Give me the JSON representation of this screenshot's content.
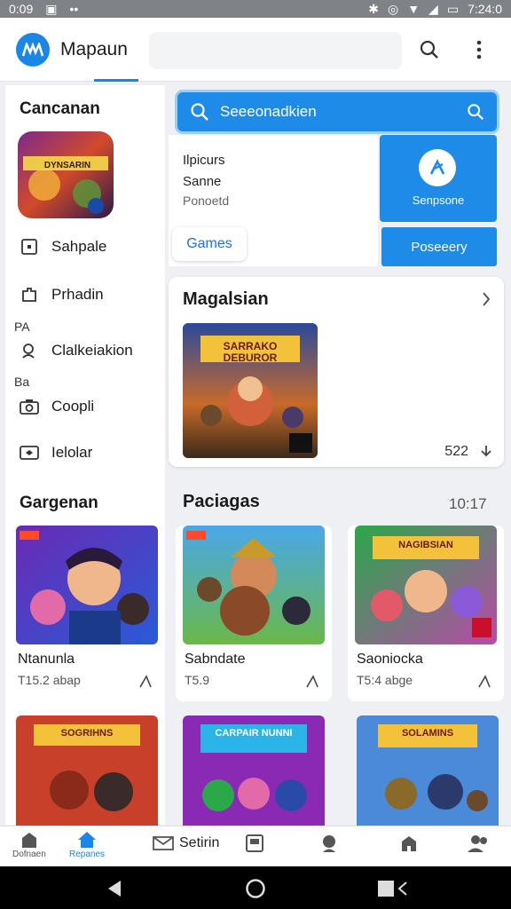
{
  "status_bar": {
    "time": "0:09",
    "clock": "7:24:0"
  },
  "app_bar": {
    "title": "Mapaun"
  },
  "sidebar": {
    "heading": "Cancanan",
    "featured_caption": "DYNSARIN",
    "items": [
      {
        "label": "Sahpale",
        "icon": "square-dot-icon"
      },
      {
        "label": "Prhadin",
        "icon": "puzzle-icon"
      },
      {
        "label": "Clalkeiakion",
        "icon": "person-search-icon"
      },
      {
        "label": "Coopli",
        "icon": "camera-icon"
      },
      {
        "label": "Ielolar",
        "icon": "tag-icon"
      }
    ],
    "tags": [
      "PA",
      "Ba"
    ],
    "bottom_heading": "Gargenan"
  },
  "search": {
    "placeholder": "Seeeonadkien"
  },
  "promo": {
    "lines": [
      "Ilpicurs",
      "Sanne",
      "Ponoetd"
    ],
    "chip": "Games",
    "primary_label": "Senpsone",
    "secondary_label": "Poseeery"
  },
  "magazine": {
    "title": "Magalsian",
    "count": "522",
    "art_caption": "SARRAKO DEBUROR"
  },
  "packages": {
    "title": "Paciagas",
    "time": "10:17"
  },
  "grid": [
    {
      "name": "Ntanunla",
      "meta": "T15.2  abap",
      "caption": ""
    },
    {
      "name": "Sabndate",
      "meta": "T5.9",
      "caption": ""
    },
    {
      "name": "Saoniocka",
      "meta": "T5:4  abge",
      "caption": "NAGIBSIAN"
    }
  ],
  "bottom_row": [
    {
      "caption": "SOGRIHNS"
    },
    {
      "caption": "CARPAIR NUNNI"
    },
    {
      "caption": "SOLAMINS"
    }
  ],
  "bottom_nav": {
    "items": [
      {
        "label": "Dofnaen",
        "icon": "home-icon"
      },
      {
        "label": "Repanes",
        "icon": "house-icon"
      },
      {
        "label": "Setirin",
        "icon": "mail-icon"
      },
      {
        "label": "",
        "icon": "note-icon"
      },
      {
        "label": "",
        "icon": "person-icon"
      },
      {
        "label": "",
        "icon": "house-outline-icon"
      },
      {
        "label": "",
        "icon": "people-icon"
      }
    ],
    "center_text": "Setirin"
  }
}
